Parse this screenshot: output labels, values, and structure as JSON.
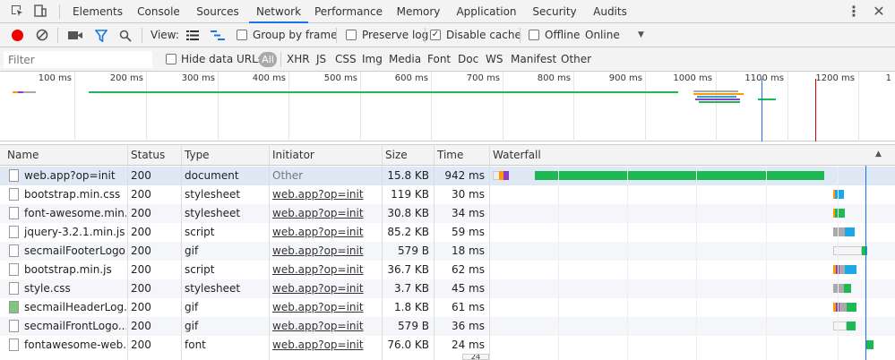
{
  "devtools": {
    "tabs": [
      "Elements",
      "Console",
      "Sources",
      "Network",
      "Performance",
      "Memory",
      "Application",
      "Security",
      "Audits"
    ],
    "active_tab": "Network"
  },
  "toolbar": {
    "view_label": "View:",
    "group_by_frame": "Group by frame",
    "preserve_log": "Preserve log",
    "disable_cache": "Disable cache",
    "offline": "Offline",
    "throttle": "Online"
  },
  "filterbar": {
    "placeholder": "Filter",
    "hide_data_urls": "Hide data URLs",
    "types": [
      "All",
      "XHR",
      "JS",
      "CSS",
      "Img",
      "Media",
      "Font",
      "Doc",
      "WS",
      "Manifest",
      "Other"
    ]
  },
  "overview": {
    "ticks": [
      "100 ms",
      "200 ms",
      "300 ms",
      "400 ms",
      "500 ms",
      "600 ms",
      "700 ms",
      "800 ms",
      "900 ms",
      "1000 ms",
      "1100 ms",
      "1200 ms",
      "1"
    ]
  },
  "table": {
    "headers": {
      "name": "Name",
      "status": "Status",
      "type": "Type",
      "initiator": "Initiator",
      "size": "Size",
      "time": "Time",
      "waterfall": "Waterfall"
    },
    "rows": [
      {
        "name": "web.app?op=init",
        "status": "200",
        "type": "document",
        "initiator": "Other",
        "size": "15.8 KB",
        "time": "942 ms"
      },
      {
        "name": "bootstrap.min.css",
        "status": "200",
        "type": "stylesheet",
        "initiator": "web.app?op=init",
        "size": "119 KB",
        "time": "30 ms"
      },
      {
        "name": "font-awesome.min...",
        "status": "200",
        "type": "stylesheet",
        "initiator": "web.app?op=init",
        "size": "30.8 KB",
        "time": "34 ms"
      },
      {
        "name": "jquery-3.2.1.min.js",
        "status": "200",
        "type": "script",
        "initiator": "web.app?op=init",
        "size": "85.2 KB",
        "time": "59 ms"
      },
      {
        "name": "secmailFooterLogo...",
        "status": "200",
        "type": "gif",
        "initiator": "web.app?op=init",
        "size": "579 B",
        "time": "18 ms"
      },
      {
        "name": "bootstrap.min.js",
        "status": "200",
        "type": "script",
        "initiator": "web.app?op=init",
        "size": "36.7 KB",
        "time": "62 ms"
      },
      {
        "name": "style.css",
        "status": "200",
        "type": "stylesheet",
        "initiator": "web.app?op=init",
        "size": "3.7 KB",
        "time": "45 ms"
      },
      {
        "name": "secmailHeaderLog...",
        "status": "200",
        "type": "gif",
        "initiator": "web.app?op=init",
        "size": "1.8 KB",
        "time": "61 ms"
      },
      {
        "name": "secmailFrontLogo...",
        "status": "200",
        "type": "gif",
        "initiator": "web.app?op=init",
        "size": "579 B",
        "time": "36 ms"
      },
      {
        "name": "fontawesome-web...",
        "status": "200",
        "type": "font",
        "initiator": "web.app?op=init",
        "size": "76.0 KB",
        "time": "24 ms"
      }
    ],
    "tooltip": "24"
  },
  "colors": {
    "accent": "#1a73e8",
    "record": "#e00",
    "waterfall_green": "#1db954",
    "waterfall_blue": "#1ea7e8"
  }
}
